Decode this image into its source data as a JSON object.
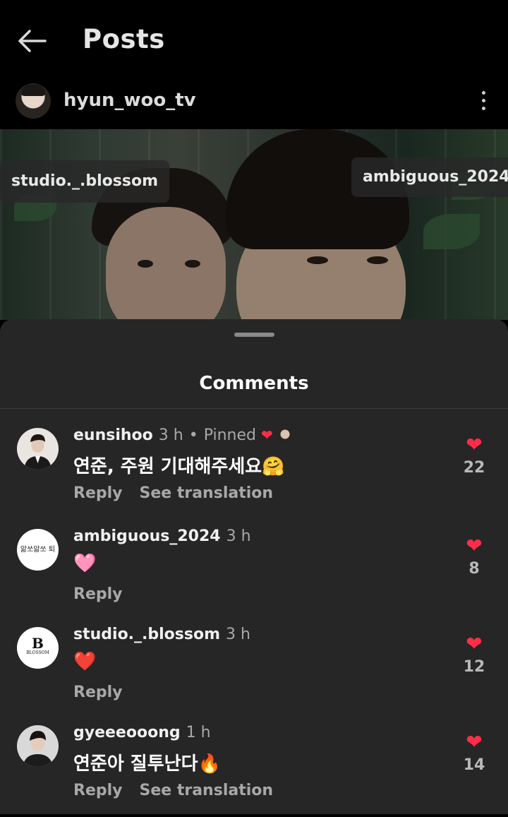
{
  "header": {
    "title": "Posts"
  },
  "post": {
    "username": "hyun_woo_tv",
    "tags": [
      "studio._.blossom",
      "ambiguous_2024"
    ]
  },
  "sheet": {
    "title": "Comments"
  },
  "comments": [
    {
      "user": "eunsihoo",
      "time": "3 h",
      "pinned": "Pinned",
      "text": "연준, 주원 기대해주세요🤗",
      "reply": "Reply",
      "translate": "See translation",
      "likes": "22"
    },
    {
      "user": "ambiguous_2024",
      "time": "3 h",
      "text": "🩷",
      "reply": "Reply",
      "likes": "8",
      "avatar_text": "앎쏘앎쏘 퇴"
    },
    {
      "user": "studio._.blossom",
      "time": "3 h",
      "text": "❤️",
      "reply": "Reply",
      "likes": "12",
      "avatar_text": "B",
      "avatar_sub": "BLOSSOM"
    },
    {
      "user": "gyeeeooong",
      "time": "1 h",
      "text": "연준아 질투난다🔥",
      "reply": "Reply",
      "translate": "See translation",
      "likes": "14"
    }
  ],
  "colors": {
    "like": "#ff2d48",
    "sheet_bg": "#262626"
  }
}
